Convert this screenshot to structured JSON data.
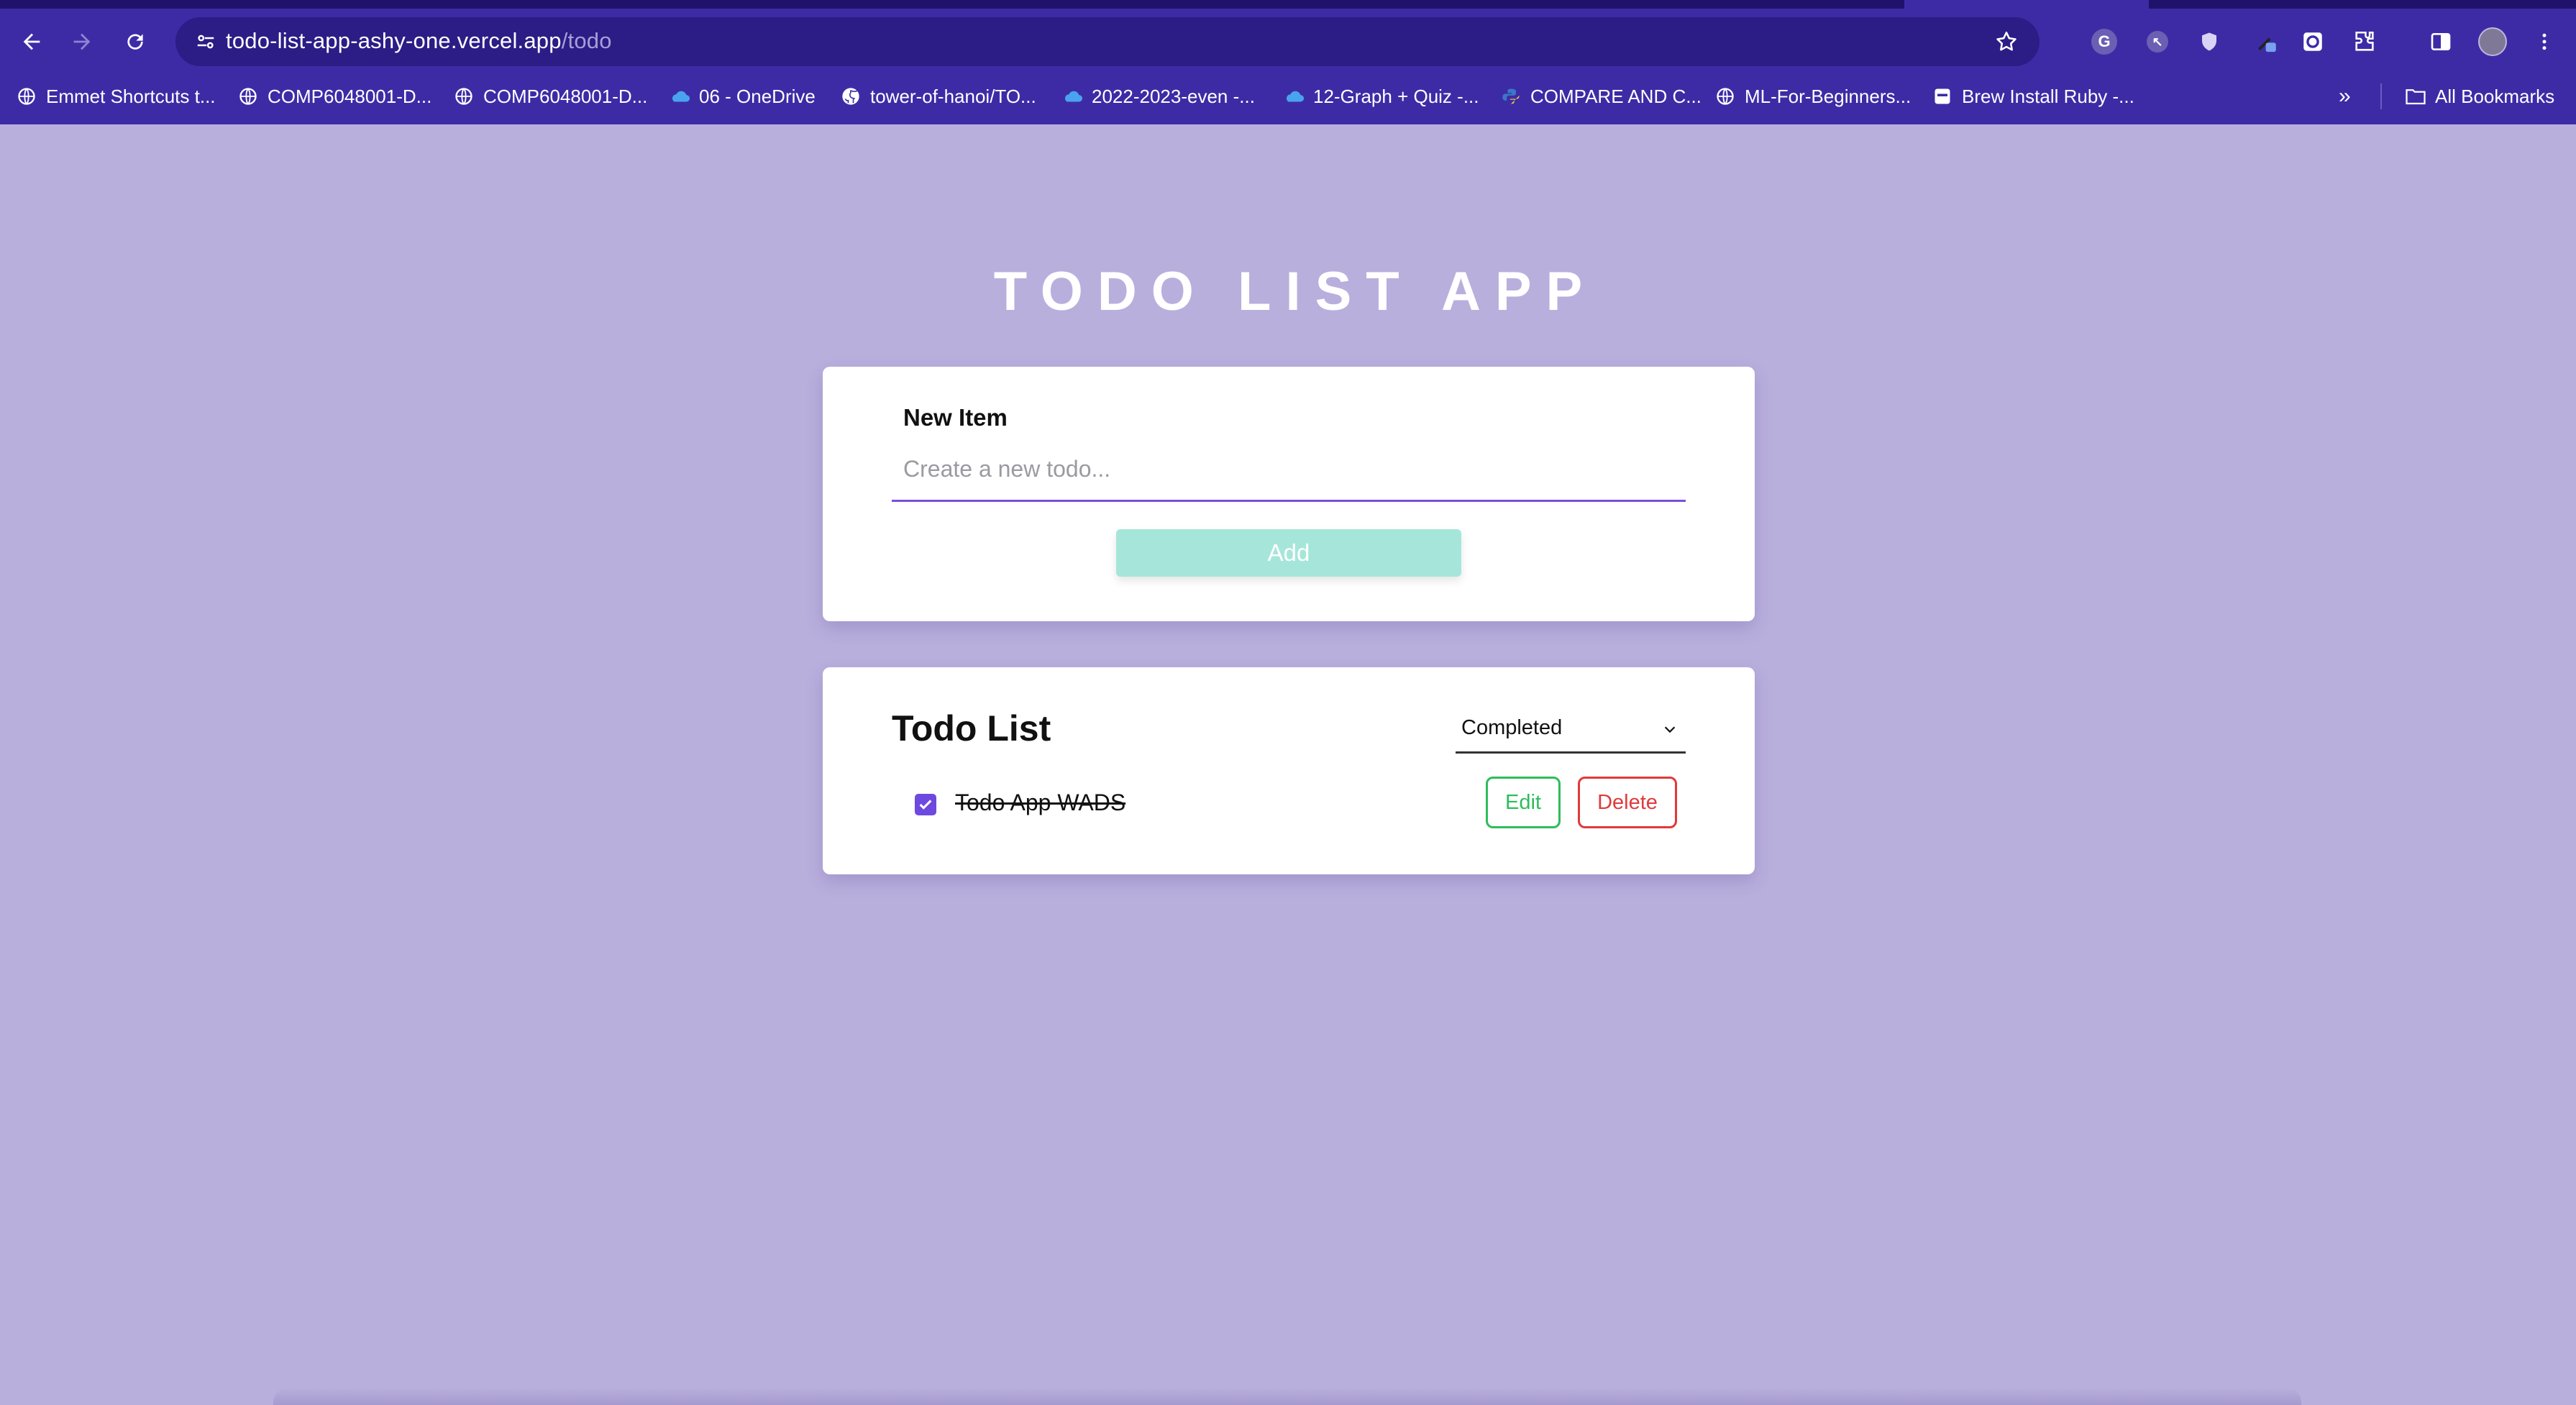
{
  "browser": {
    "url_host": "todo-list-app-ashy-one.vercel.app",
    "url_path": "/todo",
    "bookmarks": [
      {
        "label": "Emmet Shortcuts t...",
        "icon": "globe-icon"
      },
      {
        "label": "COMP6048001-D...",
        "icon": "globe-icon"
      },
      {
        "label": "COMP6048001-D...",
        "icon": "globe-icon"
      },
      {
        "label": "06 - OneDrive",
        "icon": "onedrive-icon"
      },
      {
        "label": "tower-of-hanoi/TO...",
        "icon": "github-icon"
      },
      {
        "label": "2022-2023-even -...",
        "icon": "onedrive-icon"
      },
      {
        "label": "12-Graph + Quiz -...",
        "icon": "onedrive-icon"
      },
      {
        "label": "COMPARE AND C...",
        "icon": "python-icon"
      },
      {
        "label": "ML-For-Beginners...",
        "icon": "globe-icon"
      },
      {
        "label": "Brew Install Ruby -...",
        "icon": "page-icon"
      }
    ],
    "all_bookmarks_label": "All Bookmarks",
    "overflow_label": "»"
  },
  "app": {
    "title": "TODO LIST APP",
    "new_item": {
      "label": "New Item",
      "placeholder": "Create a new todo...",
      "value": "",
      "add_label": "Add"
    },
    "todo_list": {
      "title": "Todo List",
      "filter_selected": "Completed",
      "items": [
        {
          "text": "Todo App WADS",
          "completed": true,
          "edit_label": "Edit",
          "delete_label": "Delete"
        }
      ]
    }
  },
  "colors": {
    "page_bg": "#b9afdd",
    "chrome_bg": "#3d2ba6",
    "input_underline": "#7c4ddb",
    "add_button": "#a6e6da",
    "edit": "#2ebd5b",
    "delete": "#e03a3a",
    "checkbox": "#6d49e0"
  }
}
